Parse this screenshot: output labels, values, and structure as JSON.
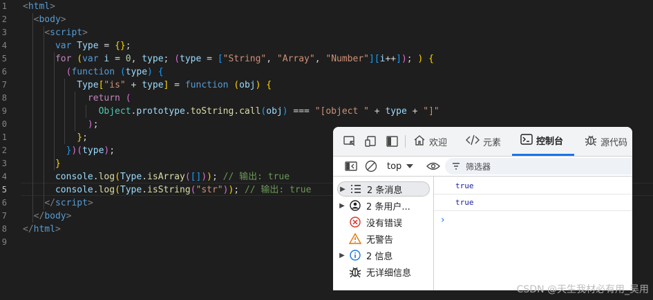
{
  "editor": {
    "line_numbers": [
      "1",
      "2",
      "3",
      "4",
      "5",
      "6",
      "7",
      "8",
      "9",
      "0",
      "1",
      "2",
      "3",
      "4",
      "5",
      "6",
      "7",
      "8",
      "9"
    ],
    "active_line": 14,
    "lines": [
      [
        [
          "t-br",
          "<"
        ],
        [
          "t-tag",
          "html"
        ],
        [
          "t-br",
          ">"
        ]
      ],
      [
        [
          "t-op",
          "  "
        ],
        [
          "t-br",
          "<"
        ],
        [
          "t-tag",
          "body"
        ],
        [
          "t-br",
          ">"
        ]
      ],
      [
        [
          "t-op",
          "    "
        ],
        [
          "t-br",
          "<"
        ],
        [
          "t-tag",
          "script"
        ],
        [
          "t-br",
          ">"
        ]
      ],
      [
        [
          "t-op",
          "      "
        ],
        [
          "t-kw",
          "var "
        ],
        [
          "t-var",
          "Type"
        ],
        [
          "t-op",
          " = "
        ],
        [
          "t-b1",
          "{}"
        ],
        [
          "t-op",
          ";"
        ]
      ],
      [
        [
          "t-op",
          "      "
        ],
        [
          "t-ctl",
          "for "
        ],
        [
          "t-b1",
          "("
        ],
        [
          "t-kw",
          "var "
        ],
        [
          "t-var",
          "i"
        ],
        [
          "t-op",
          " = "
        ],
        [
          "t-num",
          "0"
        ],
        [
          "t-op",
          ", "
        ],
        [
          "t-var",
          "type"
        ],
        [
          "t-op",
          "; "
        ],
        [
          "t-b2",
          "("
        ],
        [
          "t-var",
          "type"
        ],
        [
          "t-op",
          " = "
        ],
        [
          "t-b3",
          "["
        ],
        [
          "t-str",
          "\"String\""
        ],
        [
          "t-op",
          ", "
        ],
        [
          "t-str",
          "\"Array\""
        ],
        [
          "t-op",
          ", "
        ],
        [
          "t-str",
          "\"Number\""
        ],
        [
          "t-b3",
          "]["
        ],
        [
          "t-var",
          "i"
        ],
        [
          "t-op",
          "++"
        ],
        [
          "t-b3",
          "]"
        ],
        [
          "t-b2",
          ")"
        ],
        [
          "t-op",
          "; "
        ],
        [
          "t-b1",
          ")"
        ],
        [
          "t-op",
          " "
        ],
        [
          "t-b1",
          "{"
        ]
      ],
      [
        [
          "t-op",
          "        "
        ],
        [
          "t-b2",
          "("
        ],
        [
          "t-kw",
          "function "
        ],
        [
          "t-b3",
          "("
        ],
        [
          "t-var",
          "type"
        ],
        [
          "t-b3",
          ")"
        ],
        [
          "t-op",
          " "
        ],
        [
          "t-b3",
          "{"
        ]
      ],
      [
        [
          "t-op",
          "          "
        ],
        [
          "t-var",
          "Type"
        ],
        [
          "t-b1",
          "["
        ],
        [
          "t-str",
          "\"is\""
        ],
        [
          "t-op",
          " + "
        ],
        [
          "t-var",
          "type"
        ],
        [
          "t-b1",
          "]"
        ],
        [
          "t-op",
          " = "
        ],
        [
          "t-kw",
          "function "
        ],
        [
          "t-b1",
          "("
        ],
        [
          "t-var",
          "obj"
        ],
        [
          "t-b1",
          ")"
        ],
        [
          "t-op",
          " "
        ],
        [
          "t-b1",
          "{"
        ]
      ],
      [
        [
          "t-op",
          "            "
        ],
        [
          "t-ctl",
          "return "
        ],
        [
          "t-b2",
          "("
        ]
      ],
      [
        [
          "t-op",
          "              "
        ],
        [
          "t-cls",
          "Object"
        ],
        [
          "t-op",
          "."
        ],
        [
          "t-var",
          "prototype"
        ],
        [
          "t-op",
          "."
        ],
        [
          "t-fn",
          "toString"
        ],
        [
          "t-op",
          "."
        ],
        [
          "t-fn",
          "call"
        ],
        [
          "t-b3",
          "("
        ],
        [
          "t-var",
          "obj"
        ],
        [
          "t-b3",
          ")"
        ],
        [
          "t-op",
          " === "
        ],
        [
          "t-str",
          "\"[object \""
        ],
        [
          "t-op",
          " + "
        ],
        [
          "t-var",
          "type"
        ],
        [
          "t-op",
          " + "
        ],
        [
          "t-str",
          "\"]\""
        ]
      ],
      [
        [
          "t-op",
          "            "
        ],
        [
          "t-b2",
          ")"
        ],
        [
          "t-op",
          ";"
        ]
      ],
      [
        [
          "t-op",
          "          "
        ],
        [
          "t-b1",
          "}"
        ],
        [
          "t-op",
          ";"
        ]
      ],
      [
        [
          "t-op",
          "        "
        ],
        [
          "t-b3",
          "}"
        ],
        [
          "t-b2",
          ")"
        ],
        [
          "t-b2",
          "("
        ],
        [
          "t-var",
          "type"
        ],
        [
          "t-b2",
          ")"
        ],
        [
          "t-op",
          ";"
        ]
      ],
      [
        [
          "t-op",
          "      "
        ],
        [
          "t-b1",
          "}"
        ]
      ],
      [
        [
          "t-op",
          "      "
        ],
        [
          "t-var",
          "console"
        ],
        [
          "t-op",
          "."
        ],
        [
          "t-fn",
          "log"
        ],
        [
          "t-b1",
          "("
        ],
        [
          "t-var",
          "Type"
        ],
        [
          "t-op",
          "."
        ],
        [
          "t-fn",
          "isArray"
        ],
        [
          "t-b2",
          "("
        ],
        [
          "t-b3",
          "[]"
        ],
        [
          "t-b2",
          ")"
        ],
        [
          "t-b1",
          ")"
        ],
        [
          "t-op",
          "; "
        ],
        [
          "t-cmt",
          "// 输出: true"
        ]
      ],
      [
        [
          "t-op",
          "      "
        ],
        [
          "t-var",
          "console"
        ],
        [
          "t-op",
          "."
        ],
        [
          "t-fn",
          "log"
        ],
        [
          "t-b1",
          "("
        ],
        [
          "t-var",
          "Type"
        ],
        [
          "t-op",
          "."
        ],
        [
          "t-fn",
          "isString"
        ],
        [
          "t-b2",
          "("
        ],
        [
          "t-str",
          "\"str\""
        ],
        [
          "t-b2",
          ")"
        ],
        [
          "t-b1",
          ")"
        ],
        [
          "t-op",
          "; "
        ],
        [
          "t-cmt",
          "// 输出: true"
        ]
      ],
      [
        [
          "t-op",
          "    "
        ],
        [
          "t-br",
          "</"
        ],
        [
          "t-tag",
          "script"
        ],
        [
          "t-br",
          ">"
        ]
      ],
      [
        [
          "t-op",
          "  "
        ],
        [
          "t-br",
          "</"
        ],
        [
          "t-tag",
          "body"
        ],
        [
          "t-br",
          ">"
        ]
      ],
      [
        [
          "t-br",
          "</"
        ],
        [
          "t-tag",
          "html"
        ],
        [
          "t-br",
          ">"
        ]
      ],
      []
    ]
  },
  "devtools": {
    "tabs": [
      {
        "label": "欢迎",
        "icon": "home-icon"
      },
      {
        "label": "元素",
        "icon": "code-icon"
      },
      {
        "label": "控制台",
        "icon": "console-icon"
      },
      {
        "label": "源代码",
        "icon": "bug-icon"
      }
    ],
    "active_tab": "控制台",
    "accent_color": "#1a73e8",
    "context": {
      "value": "top"
    },
    "filter": {
      "placeholder": "筛选器"
    },
    "sidebar": [
      {
        "label": "2 条消息",
        "icon": "list-icon",
        "expandable": true,
        "selected": true
      },
      {
        "label": "2 条用户...",
        "icon": "user-circle-icon",
        "expandable": true,
        "selected": false
      },
      {
        "label": "没有错误",
        "icon": "error-icon",
        "expandable": false,
        "selected": false
      },
      {
        "label": "无警告",
        "icon": "warning-icon",
        "expandable": false,
        "selected": false
      },
      {
        "label": "2 信息",
        "icon": "info-icon",
        "expandable": true,
        "selected": false
      },
      {
        "label": "无详细信息",
        "icon": "bug-icon",
        "expandable": false,
        "selected": false
      }
    ],
    "console_output": [
      "true",
      "true"
    ],
    "prompt": "›"
  },
  "watermark": "CSDN @天生我材必有用_吴用"
}
